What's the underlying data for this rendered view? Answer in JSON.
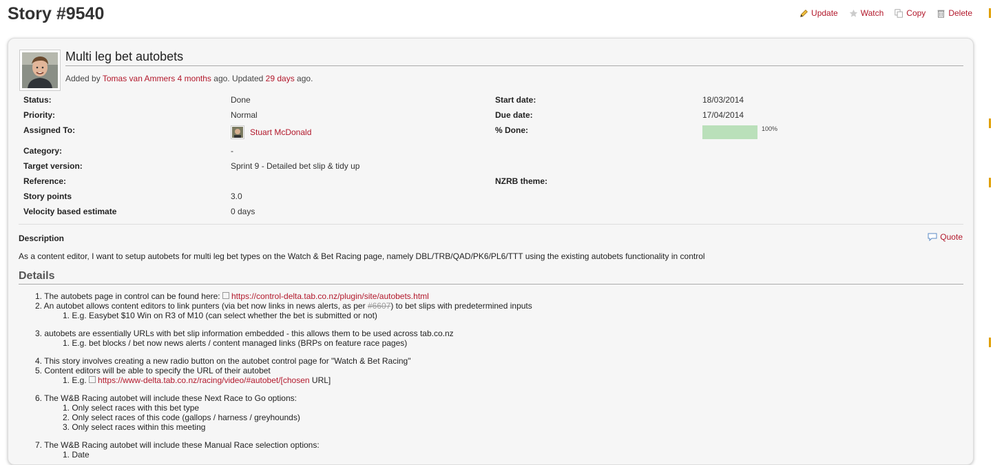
{
  "header": {
    "title": "Story #9540",
    "actions": {
      "update": "Update",
      "watch": "Watch",
      "copy": "Copy",
      "delete": "Delete"
    }
  },
  "issue": {
    "subject": "Multi leg bet autobets",
    "author": {
      "prefix": "Added by",
      "name": "Tomas van Ammers",
      "added_ago": "4 months",
      "mid": "ago. Updated",
      "updated_ago": "29 days",
      "suffix": "ago."
    },
    "attributes": {
      "status": {
        "label": "Status:",
        "value": "Done"
      },
      "start_date": {
        "label": "Start date:",
        "value": "18/03/2014"
      },
      "priority": {
        "label": "Priority:",
        "value": "Normal"
      },
      "due_date": {
        "label": "Due date:",
        "value": "17/04/2014"
      },
      "assigned_to": {
        "label": "Assigned To:",
        "value": "Stuart McDonald"
      },
      "done": {
        "label": "% Done:",
        "value": "100%",
        "fraction": 1.0
      },
      "category": {
        "label": "Category:",
        "value": "-"
      },
      "target_version": {
        "label": "Target version:",
        "value": "Sprint 9 - Detailed bet slip & tidy up"
      },
      "reference": {
        "label": "Reference:",
        "value": ""
      },
      "nzrb_theme": {
        "label": "NZRB theme:",
        "value": ""
      },
      "story_points": {
        "label": "Story points",
        "value": "3.0"
      },
      "velocity": {
        "label": "Velocity based estimate",
        "value": "0 days"
      }
    },
    "description": {
      "label": "Description",
      "quote": "Quote",
      "text": "As a content editor, I want to setup autobets for multi leg bet types on the Watch & Bet Racing page, namely DBL/TRB/QAD/PK6/PL6/TTT using the existing autobets functionality in control"
    },
    "details": {
      "heading": "Details",
      "l1_num": "1.",
      "l1_text": "The autobets page in control can be found here:",
      "l1_link": "https://control-delta.tab.co.nz/plugin/site/autobets.html",
      "l2_num": "2.",
      "l2_text": "An autobet allows content editors to link punters (via bet now links in news alerts, as per",
      "l2_ref": "#6607",
      "l2_text2": ") to bet slips with predetermined inputs",
      "l2a_num": "1.",
      "l2a_text": "E.g. Easybet $10 Win on R3 of M10 (can select whether the bet is submitted or not)",
      "l3_num": "3.",
      "l3_text": "autobets are essentially URLs with bet slip information embedded - this allows them to be used across tab.co.nz",
      "l3a_num": "1.",
      "l3a_text": "E.g. bet blocks / bet now news alerts / content managed links (BRPs on feature race pages)",
      "l4_num": "4.",
      "l4_text": "This story involves creating a new radio button on the autobet control page for \"Watch & Bet Racing\"",
      "l5_num": "5.",
      "l5_text": "Content editors will be able to specify the URL of their autobet",
      "l5a_num": "1.",
      "l5a_prefix": "E.g.",
      "l5a_link": "https://www-delta.tab.co.nz/racing/video/#autobet/[chosen",
      "l5a_suffix": "URL]",
      "l6_num": "6.",
      "l6_text": "The W&B Racing autobet will include these Next Race to Go options:",
      "l6a_num": "1.",
      "l6a_text": "Only select races with this bet type",
      "l6b_num": "2.",
      "l6b_text": "Only select races of this code (gallops / harness / greyhounds)",
      "l6c_num": "3.",
      "l6c_text": "Only select races within this meeting",
      "l7_num": "7.",
      "l7_text": "The W&B Racing autobet will include these Manual Race selection options:",
      "l7a_num": "1.",
      "l7a_text": "Date"
    }
  },
  "colors": {
    "link": "#b2182b",
    "progress_fill": "#bae0ba",
    "box_bg": "#f6f6f6"
  }
}
